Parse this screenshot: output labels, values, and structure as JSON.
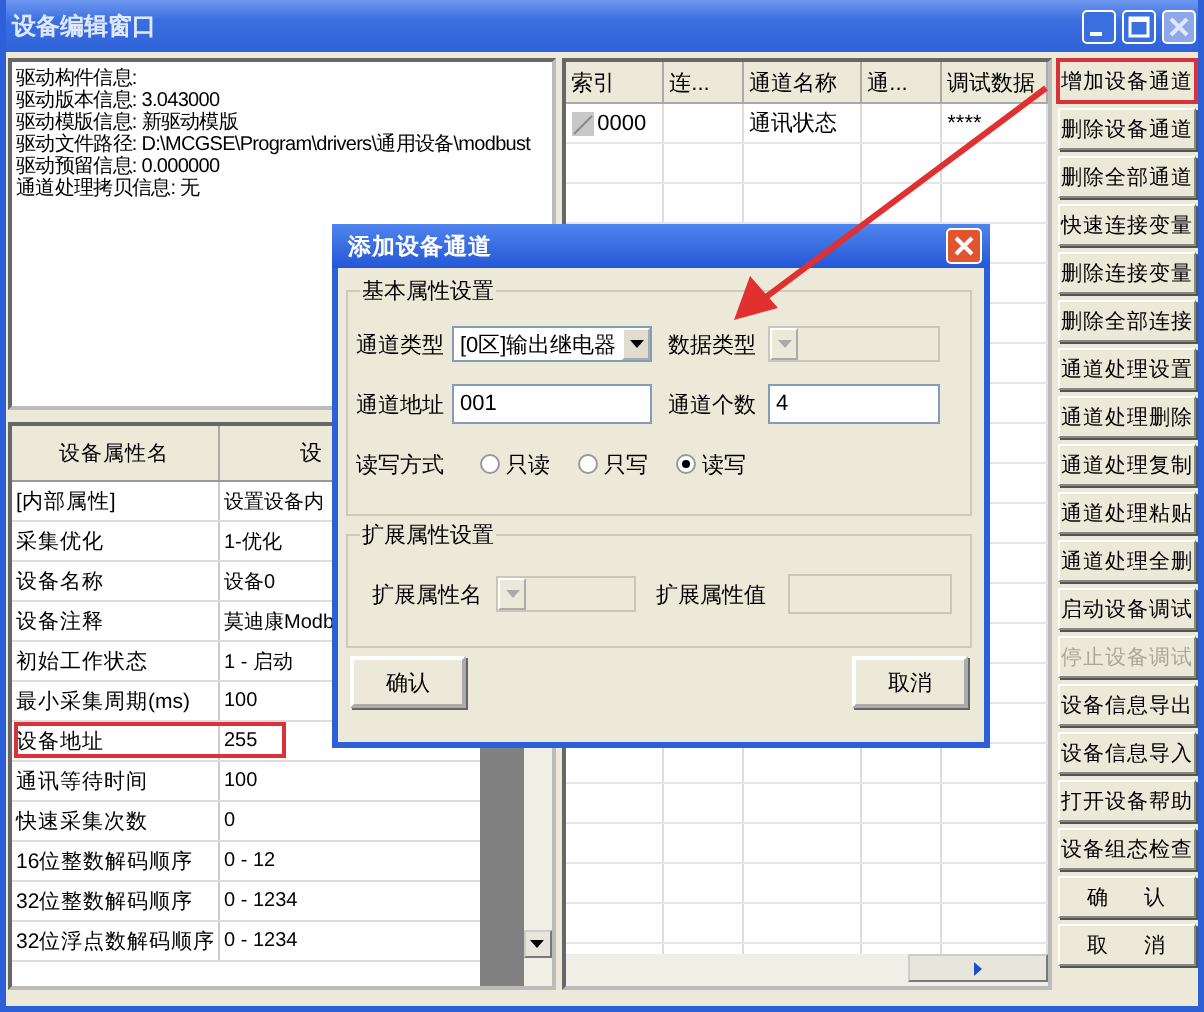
{
  "window": {
    "title": "设备编辑窗口"
  },
  "driver_info": [
    "驱动构件信息:",
    "驱动版本信息: 3.043000",
    "驱动模版信息: 新驱动模版",
    "驱动文件路径: D:\\MCGSE\\Program\\drivers\\通用设备\\modbust",
    "驱动预留信息: 0.000000",
    "通道处理拷贝信息: 无"
  ],
  "property_table": {
    "columns": [
      "设备属性名",
      "设"
    ],
    "rows": [
      {
        "name": "[内部属性]",
        "value": "设置设备内",
        "highlighted": false
      },
      {
        "name": "采集优化",
        "value": "1-优化",
        "highlighted": false
      },
      {
        "name": "设备名称",
        "value": "设备0",
        "highlighted": false
      },
      {
        "name": "设备注释",
        "value": "莫迪康Modb",
        "highlighted": false
      },
      {
        "name": "初始工作状态",
        "value": "1 - 启动",
        "highlighted": false
      },
      {
        "name": "最小采集周期(ms)",
        "value": "100",
        "highlighted": false
      },
      {
        "name": "设备地址",
        "value": "255",
        "highlighted": true
      },
      {
        "name": "通讯等待时间",
        "value": "100",
        "highlighted": false
      },
      {
        "name": "快速采集次数",
        "value": "0",
        "highlighted": false
      },
      {
        "name": "16位整数解码顺序",
        "value": "0 - 12",
        "highlighted": false
      },
      {
        "name": "32位整数解码顺序",
        "value": "0 - 1234",
        "highlighted": false
      },
      {
        "name": "32位浮点数解码顺序",
        "value": "0 - 1234",
        "highlighted": false
      }
    ]
  },
  "channel_table": {
    "columns": [
      "索引",
      "连...",
      "通道名称",
      "通...",
      "调试数据"
    ],
    "rows": [
      {
        "index": "0000",
        "channel_name": "通讯状态",
        "debug_data": "****"
      }
    ]
  },
  "buttons": [
    {
      "label": "增加设备通道",
      "disabled": false,
      "highlighted": true
    },
    {
      "label": "删除设备通道",
      "disabled": false,
      "highlighted": false
    },
    {
      "label": "删除全部通道",
      "disabled": false,
      "highlighted": false
    },
    {
      "label": "快速连接变量",
      "disabled": false,
      "highlighted": false
    },
    {
      "label": "删除连接变量",
      "disabled": false,
      "highlighted": false
    },
    {
      "label": "删除全部连接",
      "disabled": false,
      "highlighted": false
    },
    {
      "label": "通道处理设置",
      "disabled": false,
      "highlighted": false
    },
    {
      "label": "通道处理删除",
      "disabled": false,
      "highlighted": false
    },
    {
      "label": "通道处理复制",
      "disabled": false,
      "highlighted": false
    },
    {
      "label": "通道处理粘贴",
      "disabled": false,
      "highlighted": false
    },
    {
      "label": "通道处理全删",
      "disabled": false,
      "highlighted": false
    },
    {
      "label": "启动设备调试",
      "disabled": false,
      "highlighted": false
    },
    {
      "label": "停止设备调试",
      "disabled": true,
      "highlighted": false
    },
    {
      "label": "设备信息导出",
      "disabled": false,
      "highlighted": false
    },
    {
      "label": "设备信息导入",
      "disabled": false,
      "highlighted": false
    },
    {
      "label": "打开设备帮助",
      "disabled": false,
      "highlighted": false
    },
    {
      "label": "设备组态检查",
      "disabled": false,
      "highlighted": false
    },
    {
      "label": "确      认",
      "disabled": false,
      "highlighted": false
    },
    {
      "label": "取      消",
      "disabled": false,
      "highlighted": false
    }
  ],
  "dialog": {
    "title": "添加设备通道",
    "basic_group": {
      "title": "基本属性设置",
      "channel_type": {
        "label": "通道类型",
        "value": "[0区]输出继电器",
        "disabled": false
      },
      "data_type": {
        "label": "数据类型",
        "disabled": true
      },
      "channel_address": {
        "label": "通道地址",
        "value": "001"
      },
      "channel_count": {
        "label": "通道个数",
        "value": "4"
      },
      "rw_mode": {
        "label": "读写方式",
        "options": [
          {
            "label": "只读",
            "selected": false
          },
          {
            "label": "只写",
            "selected": false
          },
          {
            "label": "读写",
            "selected": true
          }
        ]
      }
    },
    "ext_group": {
      "title": "扩展属性设置",
      "ext_name": {
        "label": "扩展属性名",
        "disabled": true
      },
      "ext_value": {
        "label": "扩展属性值",
        "disabled": true
      }
    },
    "buttons": [
      {
        "label": "确认"
      },
      {
        "label": "取消"
      }
    ]
  }
}
